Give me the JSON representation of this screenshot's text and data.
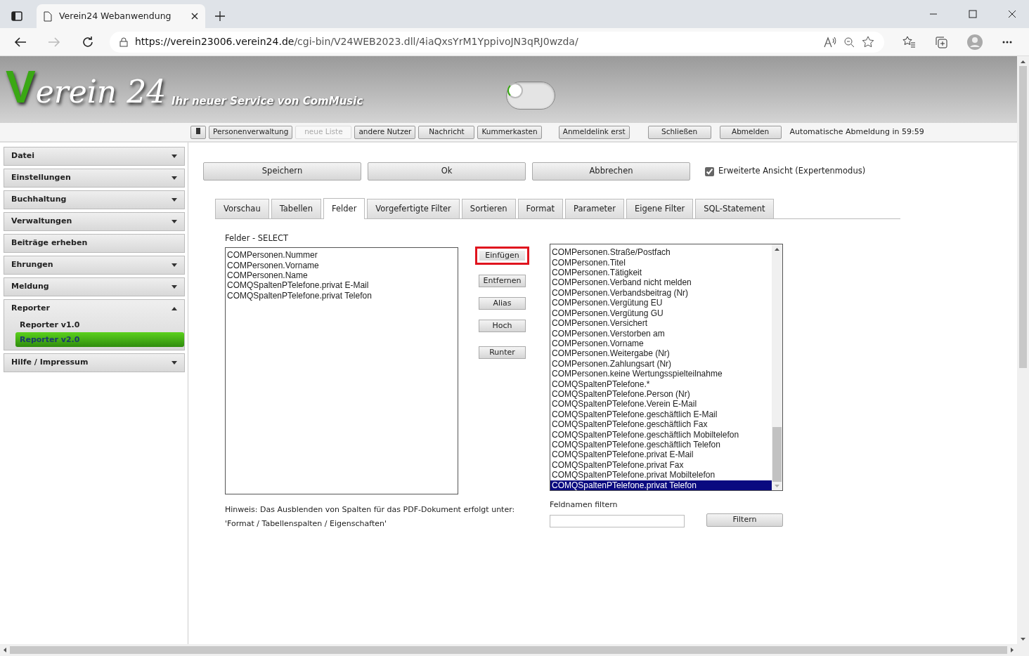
{
  "browser": {
    "tab_title": "Verein24 Webanwendung",
    "url_host": "https://verein23006.verein24.de",
    "url_path": "/cgi-bin/V24WEB2023.dll/4iaQxsYrM1YppivoJN3qRJ0wzda/"
  },
  "header": {
    "logo": "Verein 24",
    "tagline": "Ihr neuer Service von ComMusic",
    "toggle": {
      "on": false
    }
  },
  "toolbar": {
    "buttons": [
      {
        "label": "Personenverwaltung",
        "disabled": false
      },
      {
        "label": "neue Liste",
        "disabled": true
      },
      {
        "label": "andere Nutzer",
        "disabled": false
      },
      {
        "label": "Nachricht",
        "disabled": false
      },
      {
        "label": "Kummerkasten",
        "disabled": false
      },
      {
        "label": "Anmeldelink erst",
        "disabled": false
      },
      {
        "label": "Schließen",
        "disabled": false
      },
      {
        "label": "Abmelden",
        "disabled": false
      }
    ],
    "logout_info": "Automatische Abmeldung in 59:59"
  },
  "sidebar": {
    "items": [
      {
        "label": "Datei",
        "expanded": false
      },
      {
        "label": "Einstellungen",
        "expanded": false
      },
      {
        "label": "Buchhaltung",
        "expanded": false
      },
      {
        "label": "Verwaltungen",
        "expanded": false
      },
      {
        "label": "Beiträge erheben"
      },
      {
        "label": "Ehrungen",
        "expanded": false
      },
      {
        "label": "Meldung",
        "expanded": false
      },
      {
        "label": "Reporter",
        "expanded": true,
        "children": [
          {
            "label": "Reporter v1.0",
            "selected": false
          },
          {
            "label": "Reporter v2.0",
            "selected": true
          }
        ]
      },
      {
        "label": "Hilfe / Impressum",
        "expanded": false
      }
    ]
  },
  "actions": [
    "Speichern",
    "Ok",
    "Abbrechen"
  ],
  "expert_mode": {
    "label": "Erweiterte Ansicht (Expertenmodus)",
    "checked": true
  },
  "tabs": [
    {
      "label": "Vorschau",
      "selected": false
    },
    {
      "label": "Tabellen",
      "selected": false
    },
    {
      "label": "Felder",
      "selected": true
    },
    {
      "label": "Vorgefertigte Filter",
      "selected": false
    },
    {
      "label": "Sortieren",
      "selected": false
    },
    {
      "label": "Format",
      "selected": false
    },
    {
      "label": "Parameter",
      "selected": false
    },
    {
      "label": "Eigene Filter",
      "selected": false
    },
    {
      "label": "SQL-Statement",
      "selected": false
    }
  ],
  "selected_fields": {
    "label": "Felder - SELECT",
    "items": [
      "COMPersonen.Nummer",
      "COMPersonen.Vorname",
      "COMPersonen.Name",
      "COMQSpaltenPTelefone.privat E-Mail",
      "COMQSpaltenPTelefone.privat Telefon"
    ]
  },
  "field_buttons": [
    {
      "label": "Einfügen",
      "highlighted": true
    },
    {
      "label": "Entfernen",
      "highlighted": false
    },
    {
      "label": "Alias",
      "highlighted": false
    },
    {
      "label": "Hoch",
      "highlighted": false
    },
    {
      "label": "Runter",
      "highlighted": false
    }
  ],
  "available_fields": {
    "items": [
      {
        "label": "COMPersonen.Straße/Postfach",
        "selected": false
      },
      {
        "label": "COMPersonen.Titel",
        "selected": false
      },
      {
        "label": "COMPersonen.Tätigkeit",
        "selected": false
      },
      {
        "label": "COMPersonen.Verband nicht melden",
        "selected": false
      },
      {
        "label": "COMPersonen.Verbandsbeitrag (Nr)",
        "selected": false
      },
      {
        "label": "COMPersonen.Vergütung EU",
        "selected": false
      },
      {
        "label": "COMPersonen.Vergütung GU",
        "selected": false
      },
      {
        "label": "COMPersonen.Versichert",
        "selected": false
      },
      {
        "label": "COMPersonen.Verstorben am",
        "selected": false
      },
      {
        "label": "COMPersonen.Vorname",
        "selected": false
      },
      {
        "label": "COMPersonen.Weitergabe (Nr)",
        "selected": false
      },
      {
        "label": "COMPersonen.Zahlungsart (Nr)",
        "selected": false
      },
      {
        "label": "COMPersonen.keine Wertungsspielteilnahme",
        "selected": false
      },
      {
        "label": "COMQSpaltenPTelefone.*",
        "selected": false
      },
      {
        "label": "COMQSpaltenPTelefone.Person (Nr)",
        "selected": false
      },
      {
        "label": "COMQSpaltenPTelefone.Verein E-Mail",
        "selected": false
      },
      {
        "label": "COMQSpaltenPTelefone.geschäftlich E-Mail",
        "selected": false
      },
      {
        "label": "COMQSpaltenPTelefone.geschäftlich Fax",
        "selected": false
      },
      {
        "label": "COMQSpaltenPTelefone.geschäftlich Mobiltelefon",
        "selected": false
      },
      {
        "label": "COMQSpaltenPTelefone.geschäftlich Telefon",
        "selected": false
      },
      {
        "label": "COMQSpaltenPTelefone.privat E-Mail",
        "selected": false
      },
      {
        "label": "COMQSpaltenPTelefone.privat Fax",
        "selected": false
      },
      {
        "label": "COMQSpaltenPTelefone.privat Mobiltelefon",
        "selected": false
      },
      {
        "label": "COMQSpaltenPTelefone.privat Telefon",
        "selected": true
      }
    ]
  },
  "hint": [
    "Hinweis: Das Ausblenden von Spalten für das PDF-Dokument erfolgt unter:",
    "'Format / Tabellenspalten / Eigenschaften'"
  ],
  "filter": {
    "label": "Feldnamen filtern",
    "button": "Filtern"
  }
}
